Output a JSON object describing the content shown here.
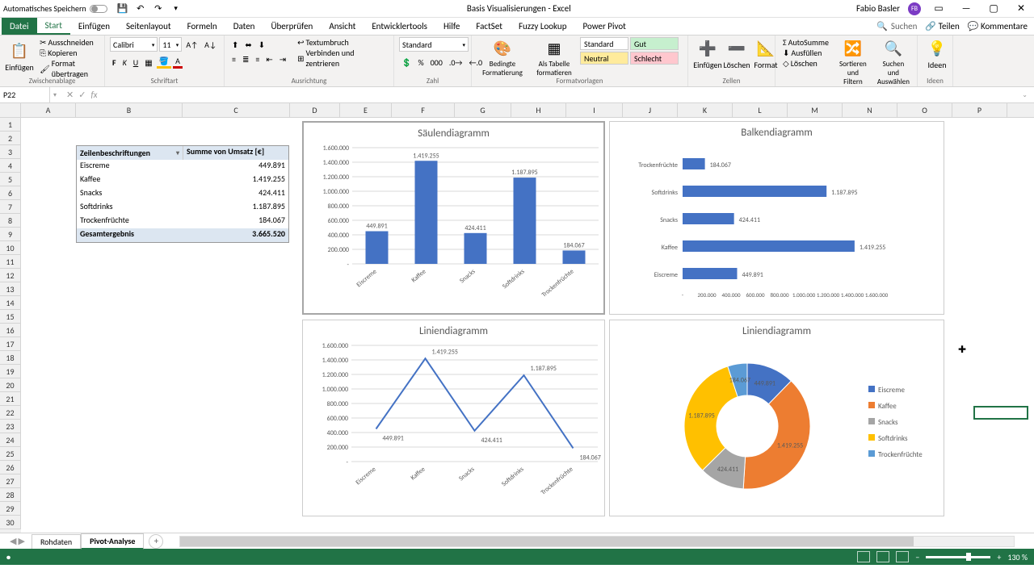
{
  "titlebar": {
    "autosave": "Automatisches Speichern",
    "doc_title": "Basis Visualisierungen - Excel",
    "user": "Fabio Basler",
    "avatar": "FB"
  },
  "ribbon_tabs": {
    "file": "Datei",
    "items": [
      "Start",
      "Einfügen",
      "Seitenlayout",
      "Formeln",
      "Daten",
      "Überprüfen",
      "Ansicht",
      "Entwicklertools",
      "Hilfe",
      "FactSet",
      "Fuzzy Lookup",
      "Power Pivot"
    ],
    "search_placeholder": "Suchen",
    "share": "Teilen",
    "comments": "Kommentare"
  },
  "ribbon": {
    "paste": "Einfügen",
    "cut": "Ausschneiden",
    "copy": "Kopieren",
    "format_painter": "Format übertragen",
    "clipboard_label": "Zwischenablage",
    "font_name": "Calibri",
    "font_size": "11",
    "font_label": "Schriftart",
    "wrap": "Textumbruch",
    "merge": "Verbinden und zentrieren",
    "align_label": "Ausrichtung",
    "number_format": "Standard",
    "number_label": "Zahl",
    "cond_format": "Bedingte Formatierung",
    "as_table": "Als Tabelle formatieren",
    "style_standard": "Standard",
    "style_neutral": "Neutral",
    "style_gut": "Gut",
    "style_schlecht": "Schlecht",
    "styles_label": "Formatvorlagen",
    "insert": "Einfügen",
    "delete": "Löschen",
    "format": "Format",
    "cells_label": "Zellen",
    "autosum": "AutoSumme",
    "fill": "Ausfüllen",
    "clear": "Löschen",
    "sort": "Sortieren und Filtern",
    "find": "Suchen und Auswählen",
    "ideas": "Ideen",
    "ideas_label": "Ideen"
  },
  "formula_bar": {
    "cell_ref": "P22"
  },
  "columns": [
    {
      "l": "A",
      "w": 68
    },
    {
      "l": "B",
      "w": 132
    },
    {
      "l": "C",
      "w": 133
    },
    {
      "l": "D",
      "w": 62
    },
    {
      "l": "E",
      "w": 64
    },
    {
      "l": "F",
      "w": 78
    },
    {
      "l": "G",
      "w": 70
    },
    {
      "l": "H",
      "w": 68
    },
    {
      "l": "I",
      "w": 70
    },
    {
      "l": "J",
      "w": 68
    },
    {
      "l": "K",
      "w": 68
    },
    {
      "l": "L",
      "w": 68
    },
    {
      "l": "M",
      "w": 68
    },
    {
      "l": "N",
      "w": 68
    },
    {
      "l": "O",
      "w": 68
    },
    {
      "l": "P",
      "w": 68
    }
  ],
  "pivot": {
    "h1": "Zeilenbeschriftungen",
    "h2": "Summe von Umsatz [€]",
    "rows": [
      {
        "k": "Eiscreme",
        "v": "449.891"
      },
      {
        "k": "Kaffee",
        "v": "1.419.255"
      },
      {
        "k": "Snacks",
        "v": "424.411"
      },
      {
        "k": "Softdrinks",
        "v": "1.187.895"
      },
      {
        "k": "Trockenfrüchte",
        "v": "184.067"
      }
    ],
    "total_k": "Gesamtergebnis",
    "total_v": "3.665.520"
  },
  "chart_data": [
    {
      "type": "bar",
      "orientation": "vertical",
      "title": "Säulendiagramm",
      "categories": [
        "Eiscreme",
        "Kaffee",
        "Snacks",
        "Softdrinks",
        "Trockenfrüchte"
      ],
      "values": [
        449891,
        1419255,
        424411,
        1187895,
        184067
      ],
      "value_labels": [
        "449.891",
        "1.419.255",
        "424.411",
        "1.187.895",
        "184.067"
      ],
      "ylim": [
        0,
        1600000
      ],
      "yticks": [
        "-",
        "200.000",
        "400.000",
        "600.000",
        "800.000",
        "1.000.000",
        "1.200.000",
        "1.400.000",
        "1.600.000"
      ]
    },
    {
      "type": "bar",
      "orientation": "horizontal",
      "title": "Balkendiagramm",
      "categories": [
        "Trockenfrüchte",
        "Softdrinks",
        "Snacks",
        "Kaffee",
        "Eiscreme"
      ],
      "values": [
        184067,
        1187895,
        424411,
        1419255,
        449891
      ],
      "value_labels": [
        "184.067",
        "1.187.895",
        "424.411",
        "1.419.255",
        "449.891"
      ],
      "xlim": [
        0,
        1600000
      ],
      "xticks": [
        "-",
        "200.000",
        "400.000",
        "600.000",
        "800.000",
        "1.000.000",
        "1.200.000",
        "1.400.000",
        "1.600.000"
      ]
    },
    {
      "type": "line",
      "title": "Liniendiagramm",
      "categories": [
        "Eiscreme",
        "Kaffee",
        "Snacks",
        "Softdrinks",
        "Trockenfrüchte"
      ],
      "values": [
        449891,
        1419255,
        424411,
        1187895,
        184067
      ],
      "value_labels": [
        "449.891",
        "1.419.255",
        "424.411",
        "1.187.895",
        "184.067"
      ],
      "ylim": [
        0,
        1600000
      ],
      "yticks": [
        "-",
        "200.000",
        "400.000",
        "600.000",
        "800.000",
        "1.000.000",
        "1.200.000",
        "1.400.000",
        "1.600.000"
      ]
    },
    {
      "type": "pie",
      "subtype": "doughnut",
      "title": "Liniendiagramm",
      "categories": [
        "Eiscreme",
        "Kaffee",
        "Snacks",
        "Softdrinks",
        "Trockenfrüchte"
      ],
      "values": [
        449891,
        1419255,
        424411,
        1187895,
        184067
      ],
      "value_labels": [
        "449.891",
        "1.419.255",
        "424.411",
        "1.187.895",
        "184.067"
      ],
      "colors": [
        "#4472c4",
        "#ed7d31",
        "#a5a5a5",
        "#ffc000",
        "#5b9bd5"
      ]
    }
  ],
  "sheets": {
    "tabs": [
      "Rohdaten",
      "Pivot-Analyse"
    ],
    "active": 1
  },
  "statusbar": {
    "zoom": "130 %"
  }
}
